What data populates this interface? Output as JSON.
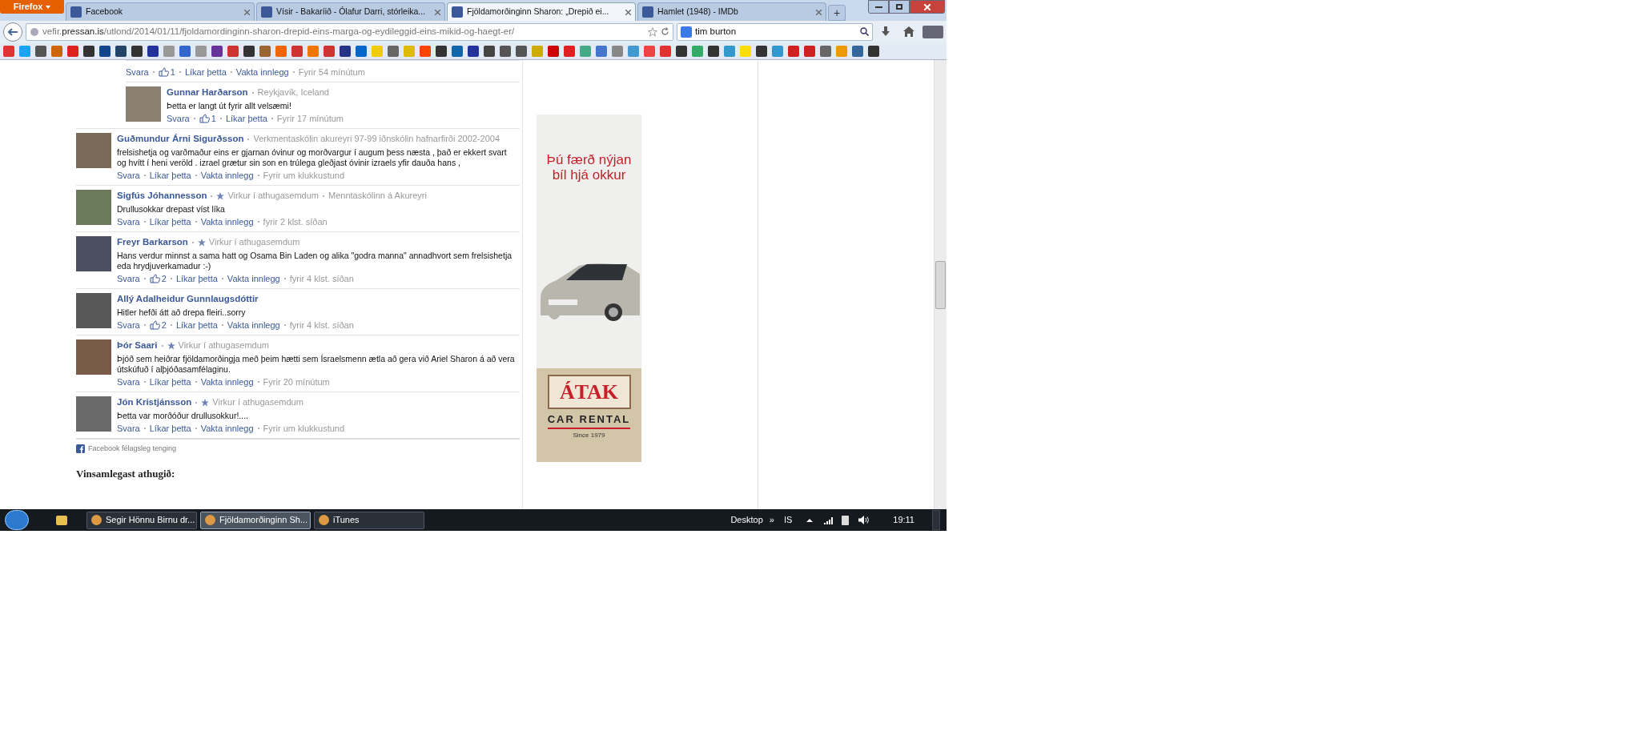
{
  "browser": {
    "menu_button": "Firefox",
    "tabs": [
      {
        "title": "Facebook",
        "selected": false
      },
      {
        "title": "Vísir - Bakaríið - Ólafur Darri, stórleika...",
        "selected": false
      },
      {
        "title": "Fjöldamorðinginn Sharon: „Drepið ei...",
        "selected": true
      },
      {
        "title": "Hamlet (1948) - IMDb",
        "selected": false
      }
    ],
    "new_tab": "+",
    "url": "vefir.**pressan.is**/utlond/2014/01/11/fjoldamordinginn-sharon-drepid-eins-marga-og-eydileggid-eins-mikid-og-haegt-er/",
    "search": {
      "value": "tim burton"
    }
  },
  "thread_replies": [
    {
      "actions": {
        "reply": "Svara",
        "likes": "1",
        "like": "Líkar þetta",
        "follow": "Vakta innlegg",
        "time": "Fyrir 54 mínútum"
      }
    },
    {
      "name": "Gunnar Harðarson",
      "meta": "Reykjavík, Iceland",
      "text": "Þetta er langt út fyrir allt velsæmi!",
      "actions": {
        "reply": "Svara",
        "likes": "1",
        "like": "Líkar þetta",
        "time": "Fyrir 17 mínútum"
      }
    }
  ],
  "comments": [
    {
      "name": "Guðmundur Árni Sigurðsson",
      "meta": "Verkmentaskólin akureyri 97-99 iðnskólin hafnarfirði 2002-2004",
      "text": "frelsishetja og varðmaður eins er gjarnan óvinur og morðvargur í augum þess næsta , það er ekkert svart og hvítt í heni veröld . izrael grætur sin son en trúlega gleðjast óvinir izraels yfir dauða hans ,",
      "actions": {
        "reply": "Svara",
        "like": "Líkar þetta",
        "follow": "Vakta innlegg",
        "time": "Fyrir um klukkustund"
      }
    },
    {
      "name": "Sigfús Jóhannesson",
      "badge": "Virkur í athugasemdum",
      "meta": "Menntaskólinn á Akureyri",
      "text": "Drullusokkar drepast víst líka",
      "actions": {
        "reply": "Svara",
        "like": "Líkar þetta",
        "follow": "Vakta innlegg",
        "time": "fyrir 2 klst. síðan"
      }
    },
    {
      "name": "Freyr Barkarson",
      "badge": "Virkur í athugasemdum",
      "text": "Hans verdur minnst a sama hatt og Osama Bin Laden og alika \"godra manna\" annadhvort sem frelsishetja eda hrydjuverkamadur :-)",
      "actions": {
        "reply": "Svara",
        "likes": "2",
        "like": "Líkar þetta",
        "follow": "Vakta innlegg",
        "time": "fyrir 4 klst. síðan"
      }
    },
    {
      "name": "Allý Adalheidur Gunnlaugsdóttir",
      "text": "Hitler hefði átt að drepa fleiri..sorry",
      "actions": {
        "reply": "Svara",
        "likes": "2",
        "like": "Líkar þetta",
        "follow": "Vakta innlegg",
        "time": "fyrir 4 klst. síðan"
      }
    },
    {
      "name": "Þór Saari",
      "badge": "Virkur í athugasemdum",
      "text": "Þjóð sem heiðrar fjöldamorðingja með þeim hætti sem Ísraelsmenn ætla að gera við Ariel Sharon á að vera útskúfuð í alþjóðasamfélaginu.",
      "actions": {
        "reply": "Svara",
        "like": "Líkar þetta",
        "follow": "Vakta innlegg",
        "time": "Fyrir 20 mínútum"
      }
    },
    {
      "name": "Jón Kristjánsson",
      "badge": "Virkur í athugasemdum",
      "text": "Þetta var morðóður drullusokkur!....",
      "actions": {
        "reply": "Svara",
        "like": "Líkar þetta",
        "follow": "Vakta innlegg",
        "time": "Fyrir um klukkustund"
      }
    }
  ],
  "plugin_footer": "Facebook félagsleg tenging",
  "notice_heading": "Vinsamlegast athugið:",
  "ad": {
    "headline": "Þú færð nýjan bíl hjá okkur",
    "brand": "ÁTAK",
    "brand_line": "CAR RENTAL",
    "since": "Since 1979"
  },
  "taskbar": {
    "items": [
      {
        "title": "Segir Hönnu Birnu dr...",
        "selected": false
      },
      {
        "title": "Fjöldamorðinginn Sh...",
        "selected": true
      },
      {
        "title": "iTunes",
        "selected": false
      }
    ],
    "desktop": "Desktop",
    "chevron": "»",
    "language": "IS",
    "clock": "19:11"
  }
}
